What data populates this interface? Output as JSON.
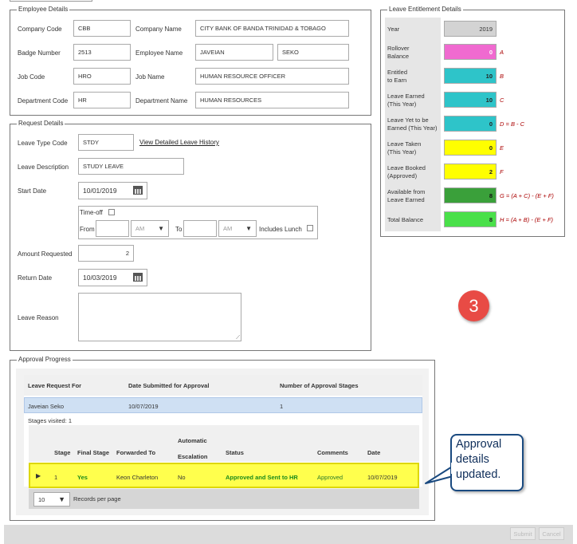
{
  "employee": {
    "legend": "Employee Details",
    "company_code_label": "Company Code",
    "company_code": "CBB",
    "company_name_label": "Company Name",
    "company_name": "CITY BANK OF BANDA TRINIDAD & TOBAGO",
    "badge_label": "Badge Number",
    "badge": "2513",
    "employee_name_label": "Employee Name",
    "first_name": "JAVEIAN",
    "last_name": "SEKO",
    "job_code_label": "Job Code",
    "job_code": "HRO",
    "job_name_label": "Job Name",
    "job_name": "HUMAN RESOURCE OFFICER",
    "dept_code_label": "Department Code",
    "dept_code": "HR",
    "dept_name_label": "Department Name",
    "dept_name": "HUMAN RESOURCES"
  },
  "request": {
    "legend": "Request Details",
    "leave_type_label": "Leave Type Code",
    "leave_type": "STDY",
    "history_link": "View Detailed Leave History",
    "desc_label": "Leave Description",
    "desc": "STUDY LEAVE",
    "start_label": "Start Date",
    "start_date": "10/01/2019",
    "timeoff_label": "Time-off",
    "from_label": "From",
    "from_ampm": "AM",
    "to_label": "To",
    "to_ampm": "AM",
    "lunch_label": "Includes Lunch",
    "amount_label": "Amount Requested",
    "amount": "2",
    "return_label": "Return Date",
    "return_date": "10/03/2019",
    "reason_label": "Leave Reason"
  },
  "entitlement": {
    "legend": "Leave Entitlement Details",
    "rows": [
      {
        "label": "Year",
        "value": "2019",
        "color": "#d3d3d3",
        "formula": ""
      },
      {
        "label": "Rollover\nBalance",
        "value": "0",
        "color": "#f06ad0",
        "formula": "A"
      },
      {
        "label": "Entitled\nto Earn",
        "value": "10",
        "color": "#2ec4c9",
        "formula": "B"
      },
      {
        "label": "Leave Earned\n(This Year)",
        "value": "10",
        "color": "#2ec4c9",
        "formula": "C"
      },
      {
        "label": "Leave Yet to be\nEarned (This Year)",
        "value": "0",
        "color": "#2ec4c9",
        "formula": "D = B - C"
      },
      {
        "label": "Leave Taken\n(This Year)",
        "value": "0",
        "color": "#ffff00",
        "formula": "E"
      },
      {
        "label": "Leave Booked\n(Approved)",
        "value": "2",
        "color": "#ffff00",
        "formula": "F"
      },
      {
        "label": "Available from\nLeave Earned",
        "value": "8",
        "color": "#3aa03a",
        "formula": "G = (A + C) - (E + F)"
      },
      {
        "label": "Total Balance",
        "value": "8",
        "color": "#4ae04a",
        "formula": "H = (A + B) - (E + F)"
      }
    ]
  },
  "step_badge": "3",
  "approval": {
    "legend": "Approval Progress",
    "headers": [
      "Leave Request For",
      "Date Submitted for Approval",
      "Number of Approval Stages"
    ],
    "row": [
      "Javeian Seko",
      "10/07/2019",
      "1"
    ],
    "stages_visited": "Stages visited: 1",
    "stage_headers": {
      "stage": "Stage",
      "final": "Final Stage",
      "forwarded": "Forwarded To",
      "auto": "Automatic\nEscalation",
      "status": "Status",
      "comments": "Comments",
      "date": "Date"
    },
    "stage_row": {
      "stage": "1",
      "final": "Yes",
      "forwarded": "Keon Charleton",
      "auto": "No",
      "status": "Approved and Sent to HR",
      "comments": "Approved",
      "date": "10/07/2019"
    },
    "records_value": "10",
    "records_label": "Records per page"
  },
  "callout": "Approval\ndetails\nupdated.",
  "footer": {
    "submit": "Submit",
    "cancel": "Cancel"
  }
}
